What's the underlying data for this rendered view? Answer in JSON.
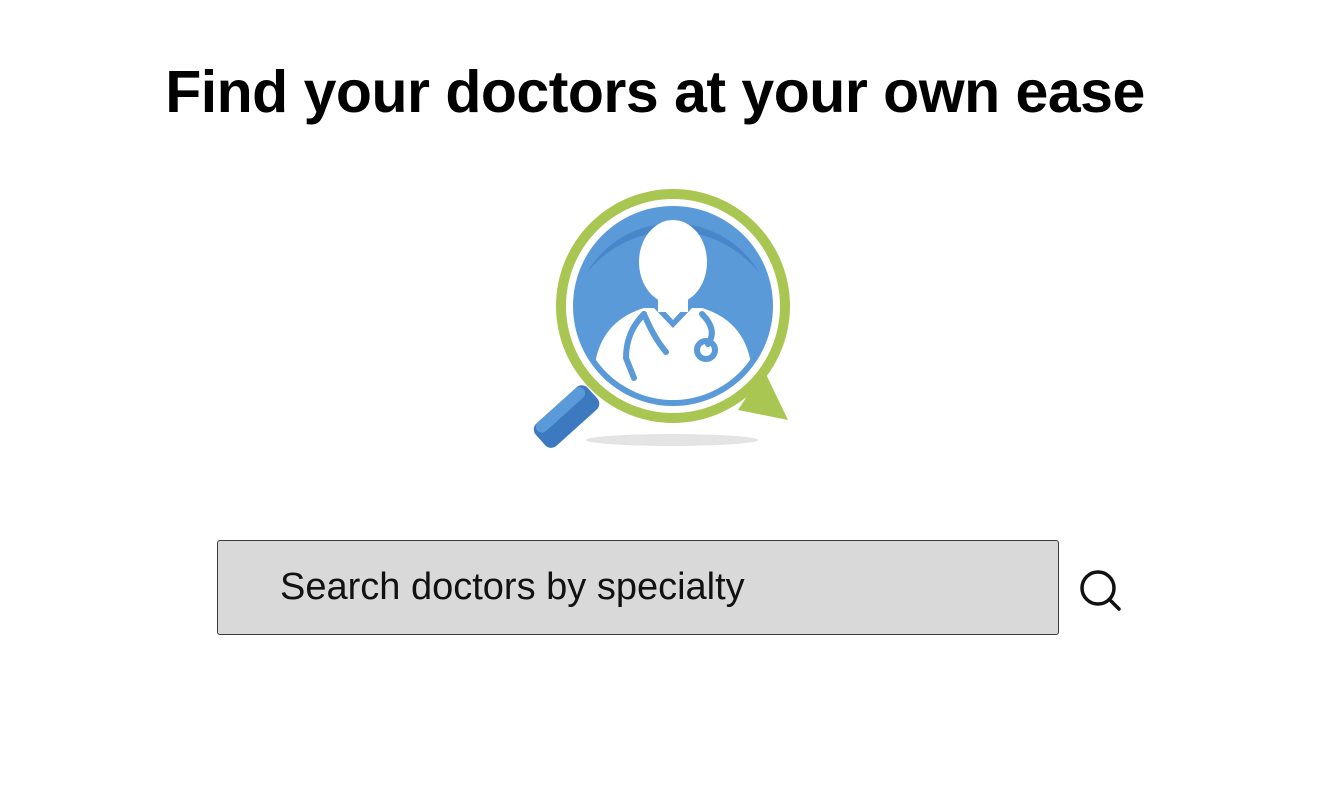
{
  "header": {
    "title": "Find your doctors at your own ease"
  },
  "hero": {
    "icon": "doctor-search-icon",
    "colors": {
      "ring_green": "#a9c653",
      "fill_blue": "#5a9ad8",
      "dark_blue": "#3d79bf",
      "white": "#ffffff",
      "shadow": "#e4e4e4"
    }
  },
  "search": {
    "placeholder": "Search doctors by specialty",
    "value": "",
    "button_icon": "search-icon",
    "field_color": "#d9d9d9",
    "border_color": "#3a3a3a"
  }
}
